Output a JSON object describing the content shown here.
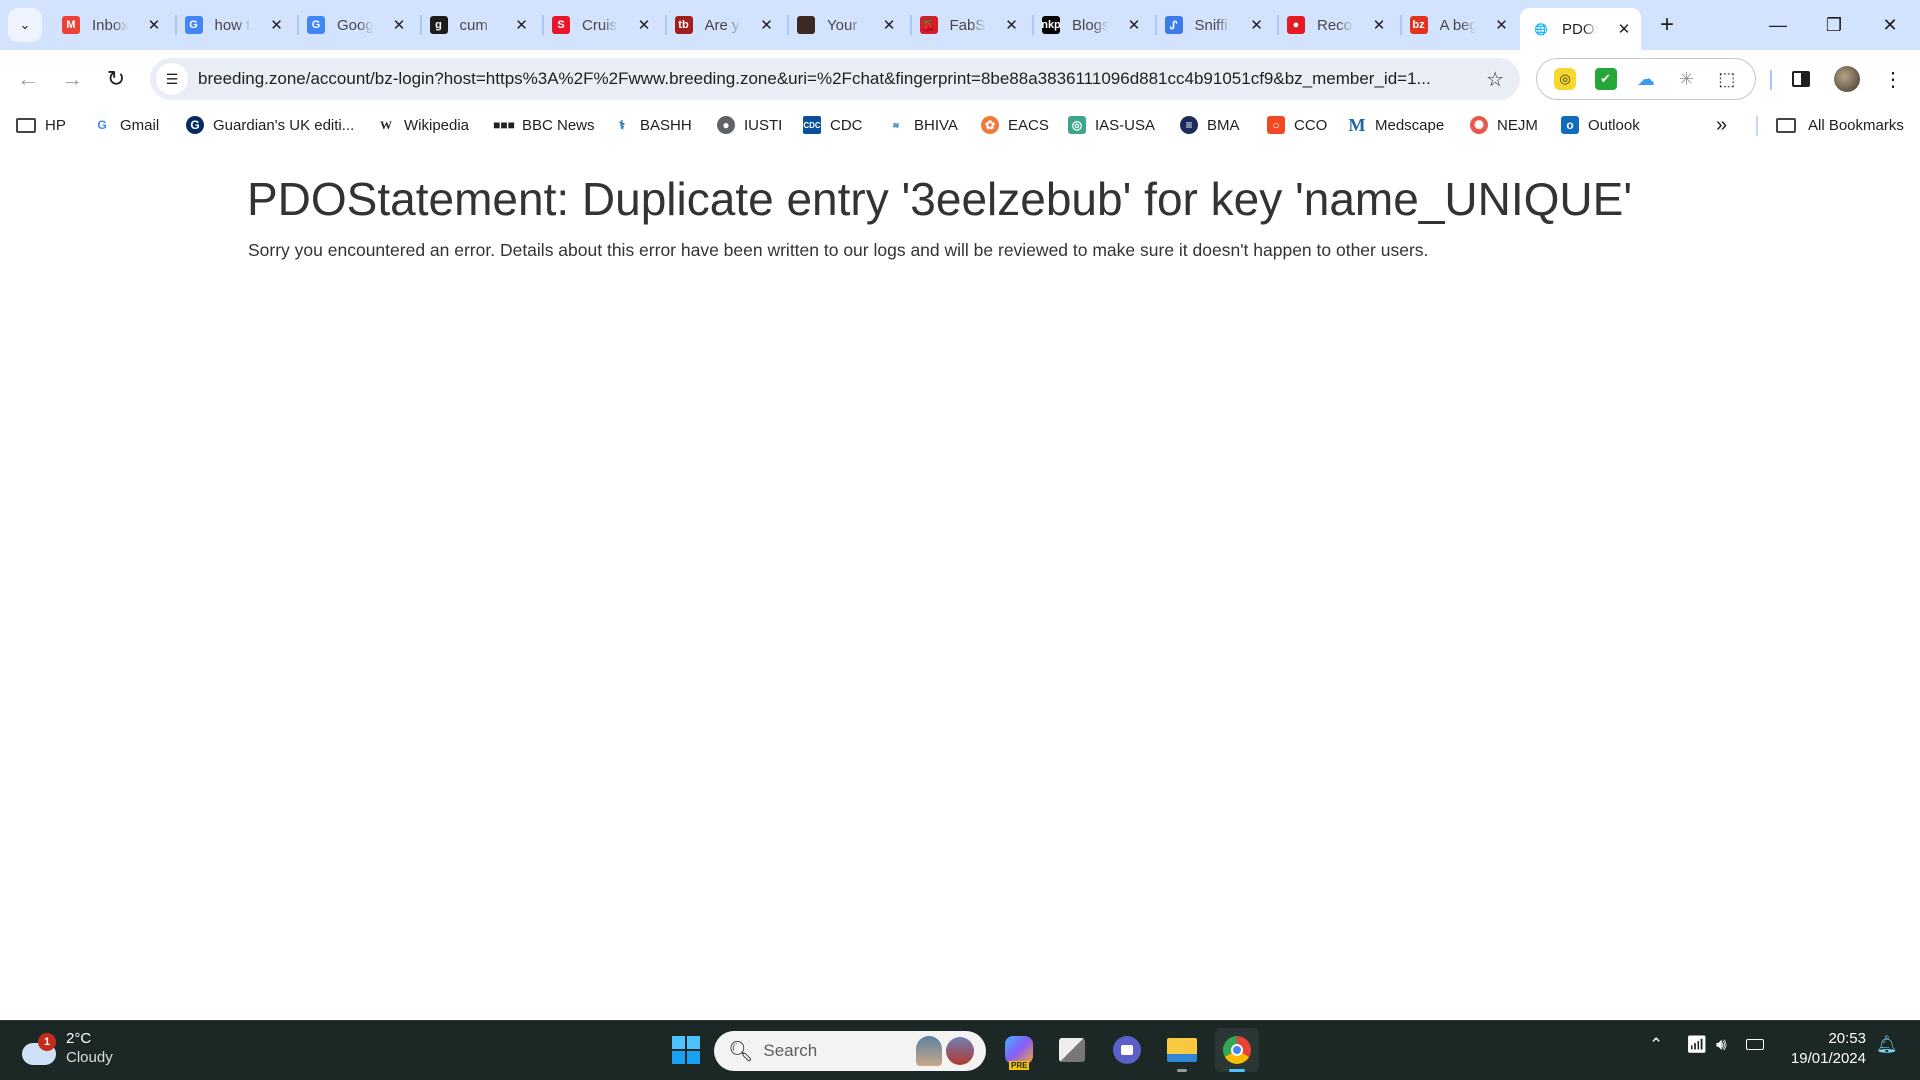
{
  "tabs": [
    {
      "title": "Inbox",
      "favicon": "gmail-icon",
      "color": "#ea4335",
      "glyph": "M"
    },
    {
      "title": "how t",
      "favicon": "google-icon",
      "color": "#4285f4",
      "glyph": "G"
    },
    {
      "title": "Goog",
      "favicon": "google-translate-icon",
      "color": "#4285f4",
      "glyph": "G"
    },
    {
      "title": "cum",
      "favicon": "site-icon",
      "color": "#1c1c1c",
      "glyph": "g"
    },
    {
      "title": "Cruis",
      "favicon": "site-icon",
      "color": "#e8162a",
      "glyph": "S"
    },
    {
      "title": "Are y",
      "favicon": "site-icon",
      "color": "#a0201c",
      "glyph": "tb"
    },
    {
      "title": "Your",
      "favicon": "site-icon",
      "color": "#3a2a22",
      "glyph": ""
    },
    {
      "title": "FabS",
      "favicon": "cherry-icon",
      "color": "#d21f2b",
      "glyph": "🍒"
    },
    {
      "title": "Blogs",
      "favicon": "site-icon",
      "color": "#000000",
      "glyph": "nkp"
    },
    {
      "title": "Sniffi",
      "favicon": "site-icon",
      "color": "#3b7be8",
      "glyph": "ᔑ"
    },
    {
      "title": "Reco",
      "favicon": "record-icon",
      "color": "#e51b23",
      "glyph": "●"
    },
    {
      "title": "A beg",
      "favicon": "site-icon",
      "color": "#e2331e",
      "glyph": "bz"
    },
    {
      "title": "PDOS",
      "favicon": "globe-icon",
      "color": "#5f6368",
      "glyph": "🌐",
      "active": true
    }
  ],
  "toolbar": {
    "url": "breeding.zone/account/bz-login?host=https%3A%2F%2Fwww.breeding.zone&uri=%2Fchat&fingerprint=8be88a3836111096d881cc4b91051cf9&bz_member_id=1..."
  },
  "bookmarks": [
    {
      "label": "HP",
      "icon": "folder-icon"
    },
    {
      "label": "Gmail",
      "icon": "google-icon"
    },
    {
      "label": "Guardian's UK editi...",
      "icon": "guardian-icon"
    },
    {
      "label": "Wikipedia",
      "icon": "wikipedia-icon"
    },
    {
      "label": "BBC News",
      "icon": "bbc-icon"
    },
    {
      "label": "BASHH",
      "icon": "bashh-icon"
    },
    {
      "label": "IUSTI",
      "icon": "globe-icon"
    },
    {
      "label": "CDC",
      "icon": "cdc-icon"
    },
    {
      "label": "BHIVA",
      "icon": "bhiva-icon"
    },
    {
      "label": "EACS",
      "icon": "eacs-icon"
    },
    {
      "label": "IAS-USA",
      "icon": "ias-usa-icon"
    },
    {
      "label": "BMA",
      "icon": "bma-icon"
    },
    {
      "label": "CCO",
      "icon": "cco-icon"
    },
    {
      "label": "Medscape",
      "icon": "medscape-icon"
    },
    {
      "label": "NEJM",
      "icon": "nejm-icon"
    },
    {
      "label": "Outlook",
      "icon": "outlook-icon"
    }
  ],
  "bookmarks_overflow": "»",
  "all_bookmarks": "All Bookmarks",
  "page": {
    "heading": "PDOStatement: Duplicate entry '3eelzebub' for key 'name_UNIQUE'",
    "message": "Sorry you encountered an error. Details about this error have been written to our logs and will be reviewed to make sure it doesn't happen to other users."
  },
  "taskbar": {
    "weather_temp": "2°C",
    "weather_condition": "Cloudy",
    "weather_badge": "1",
    "search_label": "Search",
    "time": "20:53",
    "date": "19/01/2024"
  }
}
